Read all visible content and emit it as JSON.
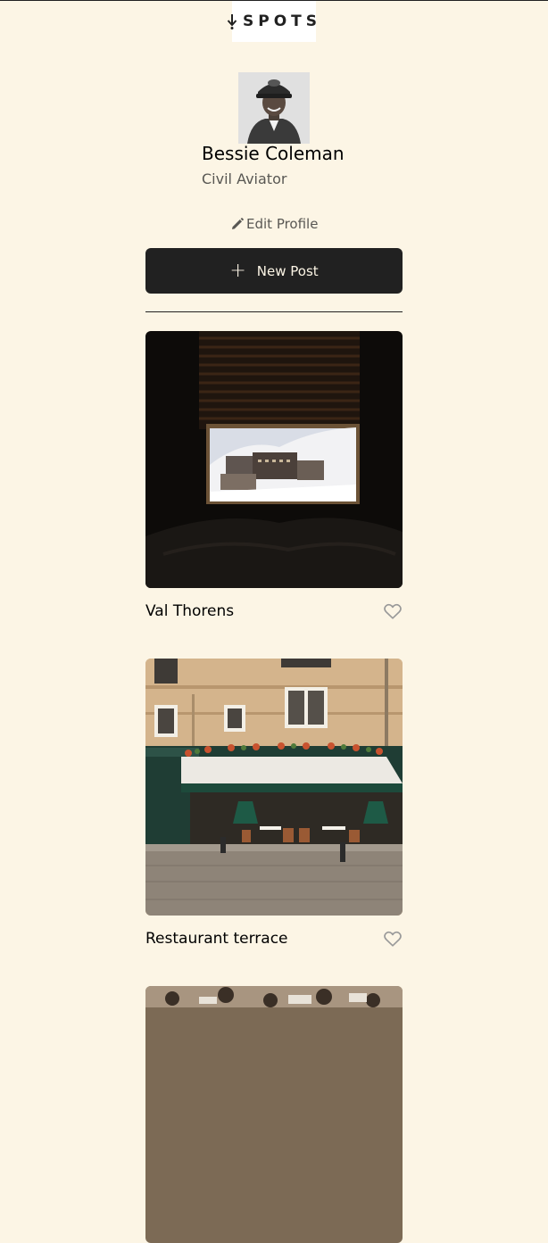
{
  "header": {
    "logo_text": "SPOTS",
    "logo_icon": "spots-logo-icon"
  },
  "profile": {
    "name": "Bessie Coleman",
    "title": "Civil Aviator",
    "avatar_icon": "avatar",
    "edit_label": "Edit Profile",
    "edit_icon": "pencil-icon"
  },
  "actions": {
    "new_post_label": "New Post",
    "new_post_icon": "plus-icon"
  },
  "cards": [
    {
      "title": "Val Thorens",
      "liked": false,
      "image_subject": "window view of snowy alpine village"
    },
    {
      "title": "Restaurant terrace",
      "liked": false,
      "image_subject": "Paris building with restaurant awning"
    },
    {
      "title": "",
      "liked": false,
      "image_subject": "cafe with people"
    }
  ],
  "colors": {
    "background": "#fcf5e5",
    "dark": "#212121",
    "heart": "#999999"
  }
}
